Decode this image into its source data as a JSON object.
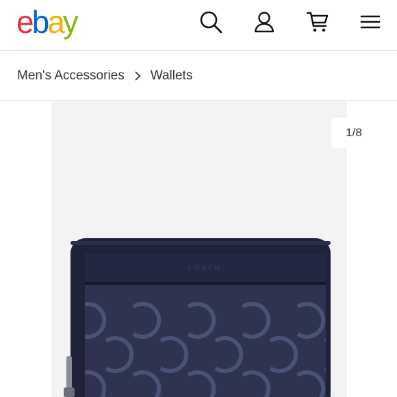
{
  "header": {
    "logo": {
      "letters": [
        "e",
        "b",
        "a",
        "y"
      ],
      "colors": [
        "#e53238",
        "#0064d2",
        "#f5af02",
        "#86b817"
      ]
    },
    "icons": [
      "search-icon",
      "user-icon",
      "cart-icon",
      "menu-icon"
    ]
  },
  "breadcrumb": {
    "items": [
      "Men's Accessories",
      "Wallets"
    ],
    "separator_icon": "chevron-right-icon"
  },
  "gallery": {
    "counter": "1/8",
    "product_brand_mark": "COACH",
    "wallet_colors": {
      "body": "#1f2238",
      "panel": "#2e3450",
      "pattern": "#4a5275"
    }
  }
}
